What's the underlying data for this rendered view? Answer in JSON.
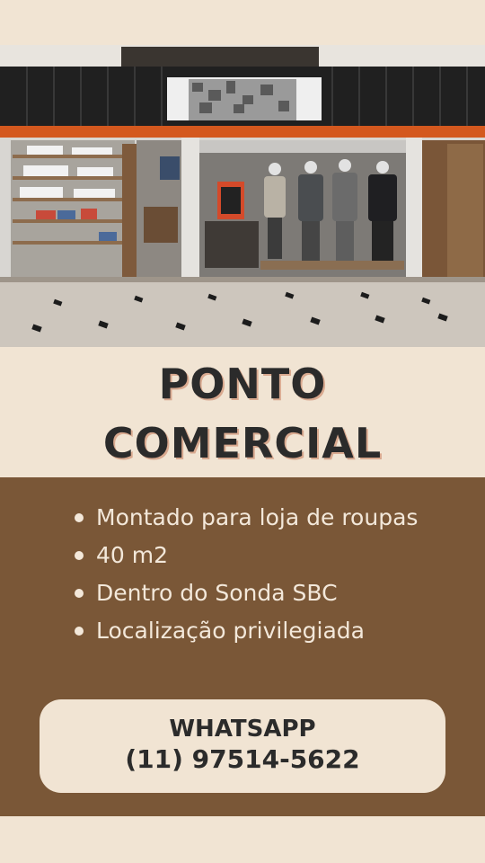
{
  "headline": {
    "line1": "PONTO",
    "line2": "COMERCIAL"
  },
  "features": [
    "Montado para loja de roupas",
    "40 m2",
    "Dentro do Sonda SBC",
    "Localização privilegiada"
  ],
  "contact": {
    "label": "WHATSAPP",
    "phone": "(11) 97514-5622"
  },
  "colors": {
    "background": "#f1e4d3",
    "panel": "#7a5737",
    "text_dark": "#2b2b2b",
    "text_light": "#f3e8da"
  }
}
